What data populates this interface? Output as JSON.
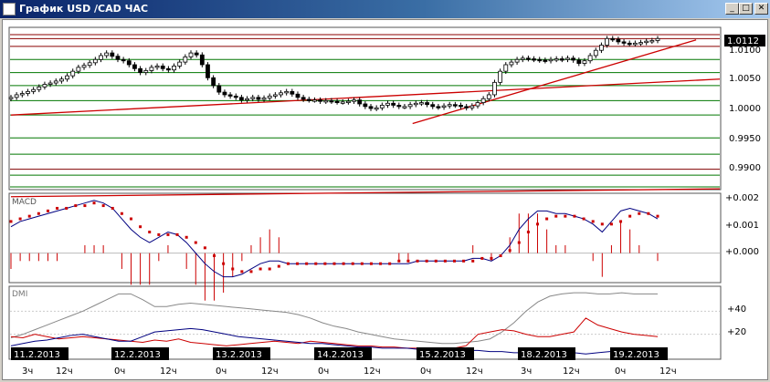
{
  "window": {
    "title": "График USD /CAD  ЧАС",
    "minimize_label": "_",
    "maximize_label": "□",
    "close_label": "✕"
  },
  "chart_data": [
    {
      "type": "candlestick",
      "title": "USD/CAD",
      "price_axis_ticks": [
        "1.0100",
        "1.0050",
        "1.0000",
        "0.9950",
        "0.9900"
      ],
      "current_price": "1.0112",
      "ylim": [
        0.9885,
        1.0125
      ],
      "close_series": [
        1.0022,
        1.0026,
        1.0028,
        1.0031,
        1.0034,
        1.0038,
        1.0042,
        1.0044,
        1.0047,
        1.005,
        1.0055,
        1.0062,
        1.0068,
        1.0071,
        1.0075,
        1.008,
        1.0086,
        1.009,
        1.0085,
        1.008,
        1.0078,
        1.0072,
        1.0066,
        1.006,
        1.0063,
        1.0068,
        1.007,
        1.0066,
        1.0064,
        1.007,
        1.0076,
        1.0084,
        1.009,
        1.0087,
        1.0072,
        1.0052,
        1.004,
        1.003,
        1.0026,
        1.0024,
        1.0022,
        1.0018,
        1.002,
        1.0022,
        1.0019,
        1.0021,
        1.0024,
        1.0026,
        1.0029,
        1.0031,
        1.0027,
        1.0022,
        1.0019,
        1.0018,
        1.0018,
        1.0016,
        1.0017,
        1.0016,
        1.0015,
        1.0015,
        1.0016,
        1.0018,
        1.0012,
        1.0008,
        1.0005,
        1.0006,
        1.001,
        1.0013,
        1.001,
        1.0008,
        1.0008,
        1.0011,
        1.0013,
        1.0014,
        1.0011,
        1.0008,
        1.0007,
        1.0009,
        1.0011,
        1.001,
        1.0008,
        1.0006,
        1.0009,
        1.0014,
        1.002,
        1.0026,
        1.0045,
        1.0062,
        1.0072,
        1.0076,
        1.008,
        1.0082,
        1.0081,
        1.008,
        1.0079,
        1.0078,
        1.008,
        1.0081,
        1.008,
        1.0082,
        1.0079,
        1.0074,
        1.0078,
        1.0086,
        1.0094,
        1.0102,
        1.0112,
        1.0111,
        1.0107,
        1.0105,
        1.0104,
        1.0105,
        1.0106,
        1.0108,
        1.0109,
        1.0112
      ],
      "trendlines": [
        {
          "color": "#cc0000",
          "from": [
            0,
            0.9995
          ],
          "to": [
            150,
            1.005
          ]
        },
        {
          "color": "#cc0000",
          "from": [
            85,
            0.9982
          ],
          "to": [
            145,
            1.011
          ]
        },
        {
          "color": "#cc0000",
          "from": [
            0,
            0.987
          ],
          "to": [
            150,
            0.9882
          ]
        }
      ],
      "horizontal_levels": [
        {
          "value": 1.0118,
          "color": "#8b0000"
        },
        {
          "value": 1.0112,
          "color": "#8b0000"
        },
        {
          "value": 1.01,
          "color": "#8b0000"
        },
        {
          "value": 1.008,
          "color": "#007700"
        },
        {
          "value": 1.006,
          "color": "#007700"
        },
        {
          "value": 1.004,
          "color": "#007700"
        },
        {
          "value": 1.0017,
          "color": "#007700"
        },
        {
          "value": 0.9995,
          "color": "#007700"
        },
        {
          "value": 0.996,
          "color": "#007700"
        },
        {
          "value": 0.9935,
          "color": "#007700"
        },
        {
          "value": 0.9912,
          "color": "#800000"
        },
        {
          "value": 0.9903,
          "color": "#007700"
        },
        {
          "value": 0.9885,
          "color": "#007700"
        }
      ]
    },
    {
      "type": "macd",
      "label": "MACD",
      "axis_ticks": [
        "+0.002",
        "+0.001",
        "+0.000"
      ],
      "ylim": [
        -0.00105,
        0.0022
      ],
      "macd_line": [
        0.001,
        0.0012,
        0.0013,
        0.0014,
        0.0015,
        0.0016,
        0.0017,
        0.0018,
        0.0019,
        0.002,
        0.0019,
        0.0017,
        0.0013,
        0.0009,
        0.0006,
        0.0004,
        0.0006,
        0.0008,
        0.0007,
        0.0004,
        0.0,
        -0.0004,
        -0.0007,
        -0.0009,
        -0.0009,
        -0.0008,
        -0.0006,
        -0.0004,
        -0.0003,
        -0.0003,
        -0.0004,
        -0.0004,
        -0.0004,
        -0.0004,
        -0.0004,
        -0.0004,
        -0.0004,
        -0.0004,
        -0.0004,
        -0.0004,
        -0.0004,
        -0.0004,
        -0.0004,
        -0.0004,
        -0.0003,
        -0.0003,
        -0.0003,
        -0.0003,
        -0.0003,
        -0.0003,
        -0.0002,
        -0.0002,
        -0.0003,
        -0.0001,
        0.0003,
        0.0009,
        0.0013,
        0.0016,
        0.0016,
        0.0015,
        0.0015,
        0.0014,
        0.0013,
        0.0011,
        0.0008,
        0.0012,
        0.0016,
        0.0017,
        0.0016,
        0.0015,
        0.0013
      ],
      "signal_line": [
        0.0012,
        0.0013,
        0.0014,
        0.0015,
        0.0016,
        0.0017,
        0.0017,
        0.0018,
        0.0018,
        0.0019,
        0.0018,
        0.0017,
        0.0015,
        0.0013,
        0.001,
        0.0008,
        0.0007,
        0.0007,
        0.0007,
        0.0006,
        0.0004,
        0.0002,
        -0.0001,
        -0.0004,
        -0.0006,
        -0.0007,
        -0.0007,
        -0.0006,
        -0.0006,
        -0.0005,
        -0.0004,
        -0.0004,
        -0.0004,
        -0.0004,
        -0.0004,
        -0.0004,
        -0.0004,
        -0.0004,
        -0.0004,
        -0.0004,
        -0.0004,
        -0.0004,
        -0.0003,
        -0.0003,
        -0.0003,
        -0.0003,
        -0.0003,
        -0.0003,
        -0.0003,
        -0.0003,
        -0.0003,
        -0.0002,
        -0.0002,
        -0.0001,
        0.0001,
        0.0004,
        0.0008,
        0.0011,
        0.0013,
        0.0014,
        0.0014,
        0.0014,
        0.0013,
        0.0012,
        0.0011,
        0.0011,
        0.0012,
        0.0014,
        0.0015,
        0.0015,
        0.0014
      ],
      "histogram_color": "#cc0000"
    },
    {
      "type": "dmi",
      "label": "DMI",
      "axis_ticks": [
        "+40",
        "+20"
      ],
      "ylim": [
        0,
        60
      ],
      "adx": [
        17,
        20,
        24,
        28,
        32,
        36,
        40,
        45,
        50,
        55,
        55,
        50,
        44,
        44,
        46,
        47,
        46,
        45,
        44,
        43,
        42,
        41,
        40,
        39,
        37,
        34,
        30,
        27,
        25,
        22,
        20,
        18,
        16,
        15,
        14,
        13,
        12,
        12,
        13,
        14,
        16,
        22,
        30,
        40,
        48,
        53,
        55,
        56,
        56,
        55,
        55,
        56,
        55,
        55,
        55
      ],
      "plus_di": [
        18,
        17,
        20,
        18,
        16,
        17,
        18,
        17,
        16,
        15,
        14,
        13,
        15,
        14,
        16,
        13,
        12,
        11,
        10,
        11,
        12,
        13,
        14,
        13,
        12,
        14,
        13,
        12,
        11,
        10,
        10,
        9,
        9,
        8,
        8,
        7,
        7,
        8,
        10,
        20,
        22,
        24,
        23,
        20,
        18,
        18,
        20,
        22,
        34,
        28,
        25,
        22,
        20,
        19,
        18
      ],
      "minus_di": [
        10,
        12,
        14,
        15,
        17,
        19,
        20,
        18,
        16,
        14,
        14,
        18,
        22,
        23,
        24,
        25,
        24,
        22,
        20,
        18,
        17,
        16,
        15,
        14,
        13,
        12,
        12,
        11,
        10,
        9,
        9,
        8,
        8,
        8,
        7,
        7,
        7,
        7,
        6,
        6,
        5,
        5,
        4,
        4,
        5,
        5,
        4,
        4,
        3,
        4,
        5,
        5,
        6,
        5,
        5
      ],
      "reference_lines": [
        40,
        20
      ]
    }
  ],
  "time_axis": {
    "date_labels": [
      "11.2.2013",
      "12.2.2013",
      "13.2.2013",
      "14.2.2013",
      "15.2.2013",
      "18.2.2013",
      "19.2.2013"
    ],
    "hour_labels": [
      "3ч",
      "12ч",
      "0ч",
      "12ч",
      "0ч",
      "12ч",
      "0ч",
      "12ч",
      "0ч",
      "12ч",
      "3ч",
      "12ч",
      "0ч",
      "12ч"
    ]
  }
}
